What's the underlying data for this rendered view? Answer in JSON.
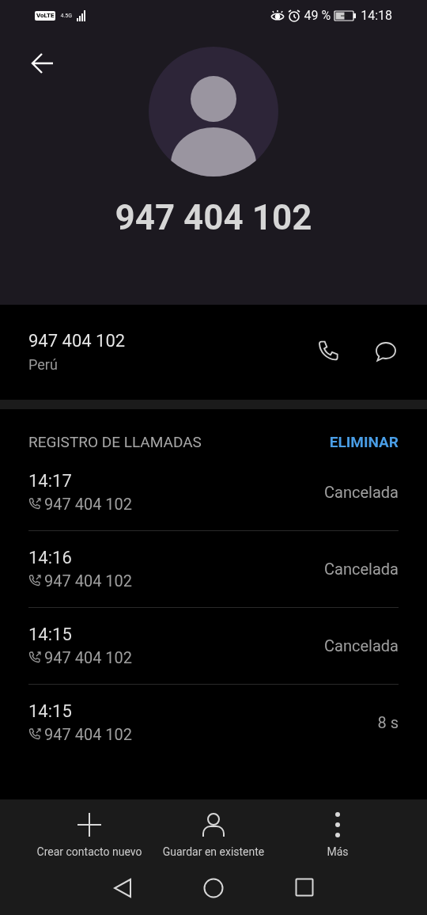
{
  "status_bar": {
    "volte": "VoLTE",
    "network": "4.5G",
    "battery": "49 %",
    "time": "14:18"
  },
  "header": {
    "title": "947 404 102"
  },
  "number_row": {
    "number": "947 404 102",
    "country": "Perú"
  },
  "call_log": {
    "title": "REGISTRO DE LLAMADAS",
    "action": "ELIMINAR",
    "rows": [
      {
        "time": "14:17",
        "number": "947 404 102",
        "status": "Cancelada"
      },
      {
        "time": "14:16",
        "number": "947 404 102",
        "status": "Cancelada"
      },
      {
        "time": "14:15",
        "number": "947 404 102",
        "status": "Cancelada"
      },
      {
        "time": "14:15",
        "number": "947 404 102",
        "status": "8 s"
      }
    ]
  },
  "bottom_actions": [
    {
      "kind": "add",
      "label": "Crear contacto nuevo"
    },
    {
      "kind": "person",
      "label": "Guardar en existente"
    },
    {
      "kind": "more",
      "label": "Más"
    }
  ]
}
